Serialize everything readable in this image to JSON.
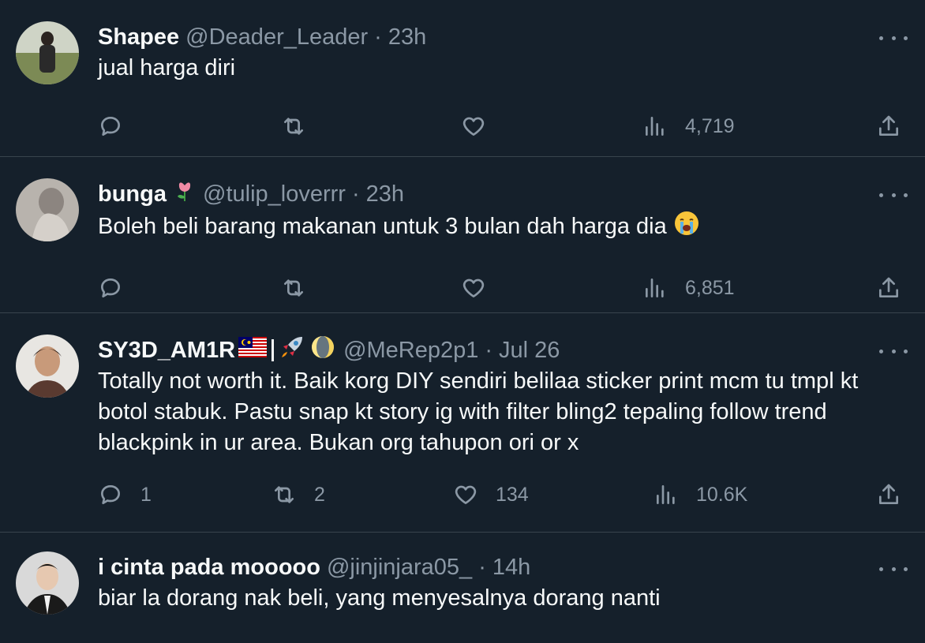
{
  "tweets": [
    {
      "name": "Shapee",
      "handle": "@Deader_Leader",
      "separator": "·",
      "time": "23h",
      "text": "jual harga diri",
      "replies": "",
      "retweets": "",
      "likes": "",
      "views": "4,719"
    },
    {
      "name": "bunga",
      "handle": "@tulip_loverrr",
      "separator": "·",
      "time": "23h",
      "text": "Boleh beli barang makanan untuk 3 bulan dah harga dia",
      "replies": "",
      "retweets": "",
      "likes": "",
      "views": "6,851",
      "name_emoji": "tulip-icon",
      "text_emoji": "crying-face-icon"
    },
    {
      "name": "SY3D_AM1R",
      "handle": "@MeRep2p1",
      "separator": "·",
      "time": "Jul 26",
      "text": "Totally not worth it. Baik korg DIY sendiri belilaa sticker print mcm tu tmpl kt botol stabuk. Pastu snap kt story ig with filter bling2 tepaling follow trend blackpink in ur area. Bukan org tahupon ori or x",
      "replies": "1",
      "retweets": "2",
      "likes": "134",
      "views": "10.6K",
      "name_emoji": [
        "malaysia-flag-icon",
        "rocket-icon",
        "moon-icon"
      ]
    },
    {
      "name": "i cinta pada mooooo",
      "handle": "@jinjinjara05_",
      "separator": "·",
      "time": "14h",
      "text": "biar la dorang nak beli, yang menyesalnya dorang nanti"
    }
  ],
  "colors": {
    "background": "#15202b",
    "divider": "#38444d",
    "primary_text": "#f7f9f9",
    "secondary_text": "#8b98a5"
  }
}
